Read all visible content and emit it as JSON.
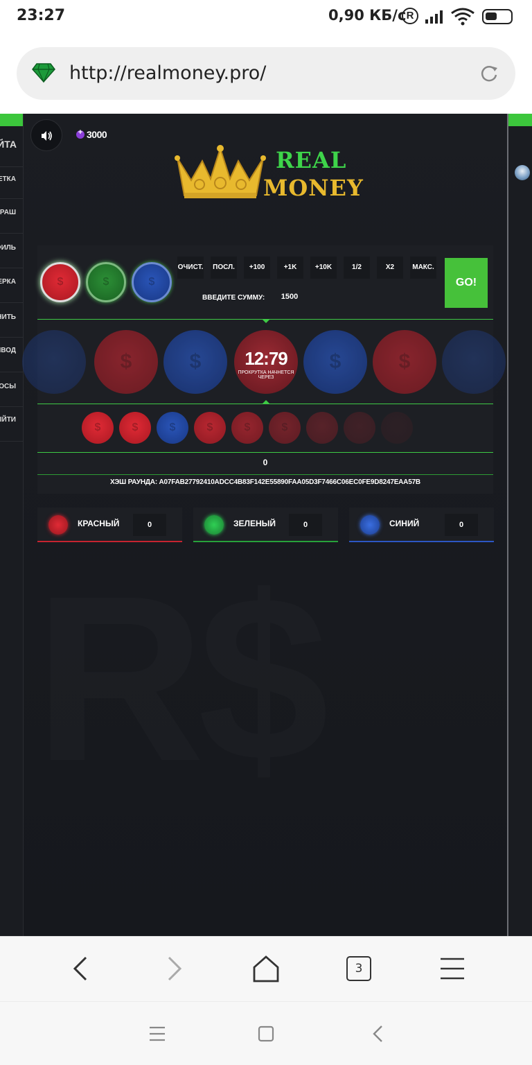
{
  "status_bar": {
    "time": "23:27",
    "network_speed": "0,90 КБ/с",
    "icons": [
      "registered-icon",
      "signal-icon",
      "wifi-icon",
      "battery-icon"
    ]
  },
  "browser": {
    "url": "http://realmoney.pro/",
    "tab_count": "3",
    "icons": [
      "site-gem-icon",
      "reload-icon",
      "back-icon",
      "forward-icon",
      "home-icon",
      "tabs-icon",
      "menu-icon"
    ]
  },
  "site": {
    "sidebar_items": [
      "АЙТА",
      "ЛЕТКА",
      "КРАШ",
      "ОФИЛЬ",
      "НЕРКА",
      "ЛНИТЬ",
      "ВЫВОД",
      "ПРОСЫ",
      "ВЫЙТИ"
    ],
    "balance": "3000",
    "logo": {
      "line1": "REAL",
      "line2": "MONEY"
    },
    "colors": {
      "accent_green": "#3ecb45",
      "logo_gold": "#e8b92e",
      "red": "#c62430",
      "green": "#27853a",
      "blue": "#2249a8"
    }
  },
  "game": {
    "bet_buttons": [
      "ОЧИСТ.",
      "ПОСЛ.",
      "+100",
      "+1K",
      "+10K",
      "1/2",
      "X2",
      "МАКС."
    ],
    "amount_label": "ВВЕДИТЕ СУММУ:",
    "amount_value": "1500",
    "go_label": "GO!",
    "timer": "12:79",
    "timer_caption": "ПРОКРУТКА НАЧНЕТСЯ ЧЕРЕЗ",
    "round_total": "0",
    "hash_text": "ХЭШ РАУНДА: A07FAB27792410ADCC4B83F142E55890FAA05D3F7466C06EC0FE9D8247EAA57B",
    "reel": [
      "blue",
      "red",
      "blue",
      "timer",
      "blue",
      "red",
      "blue"
    ],
    "history": [
      "red",
      "red",
      "blue",
      "red",
      "red",
      "red",
      "red",
      "red",
      "red"
    ]
  },
  "bets": [
    {
      "name": "КРАСНЫЙ",
      "value": "0",
      "color": "#c62430"
    },
    {
      "name": "ЗЕЛЕНЫЙ",
      "value": "0",
      "color": "#27853a"
    },
    {
      "name": "СИНИЙ",
      "value": "0",
      "color": "#2249a8"
    }
  ]
}
